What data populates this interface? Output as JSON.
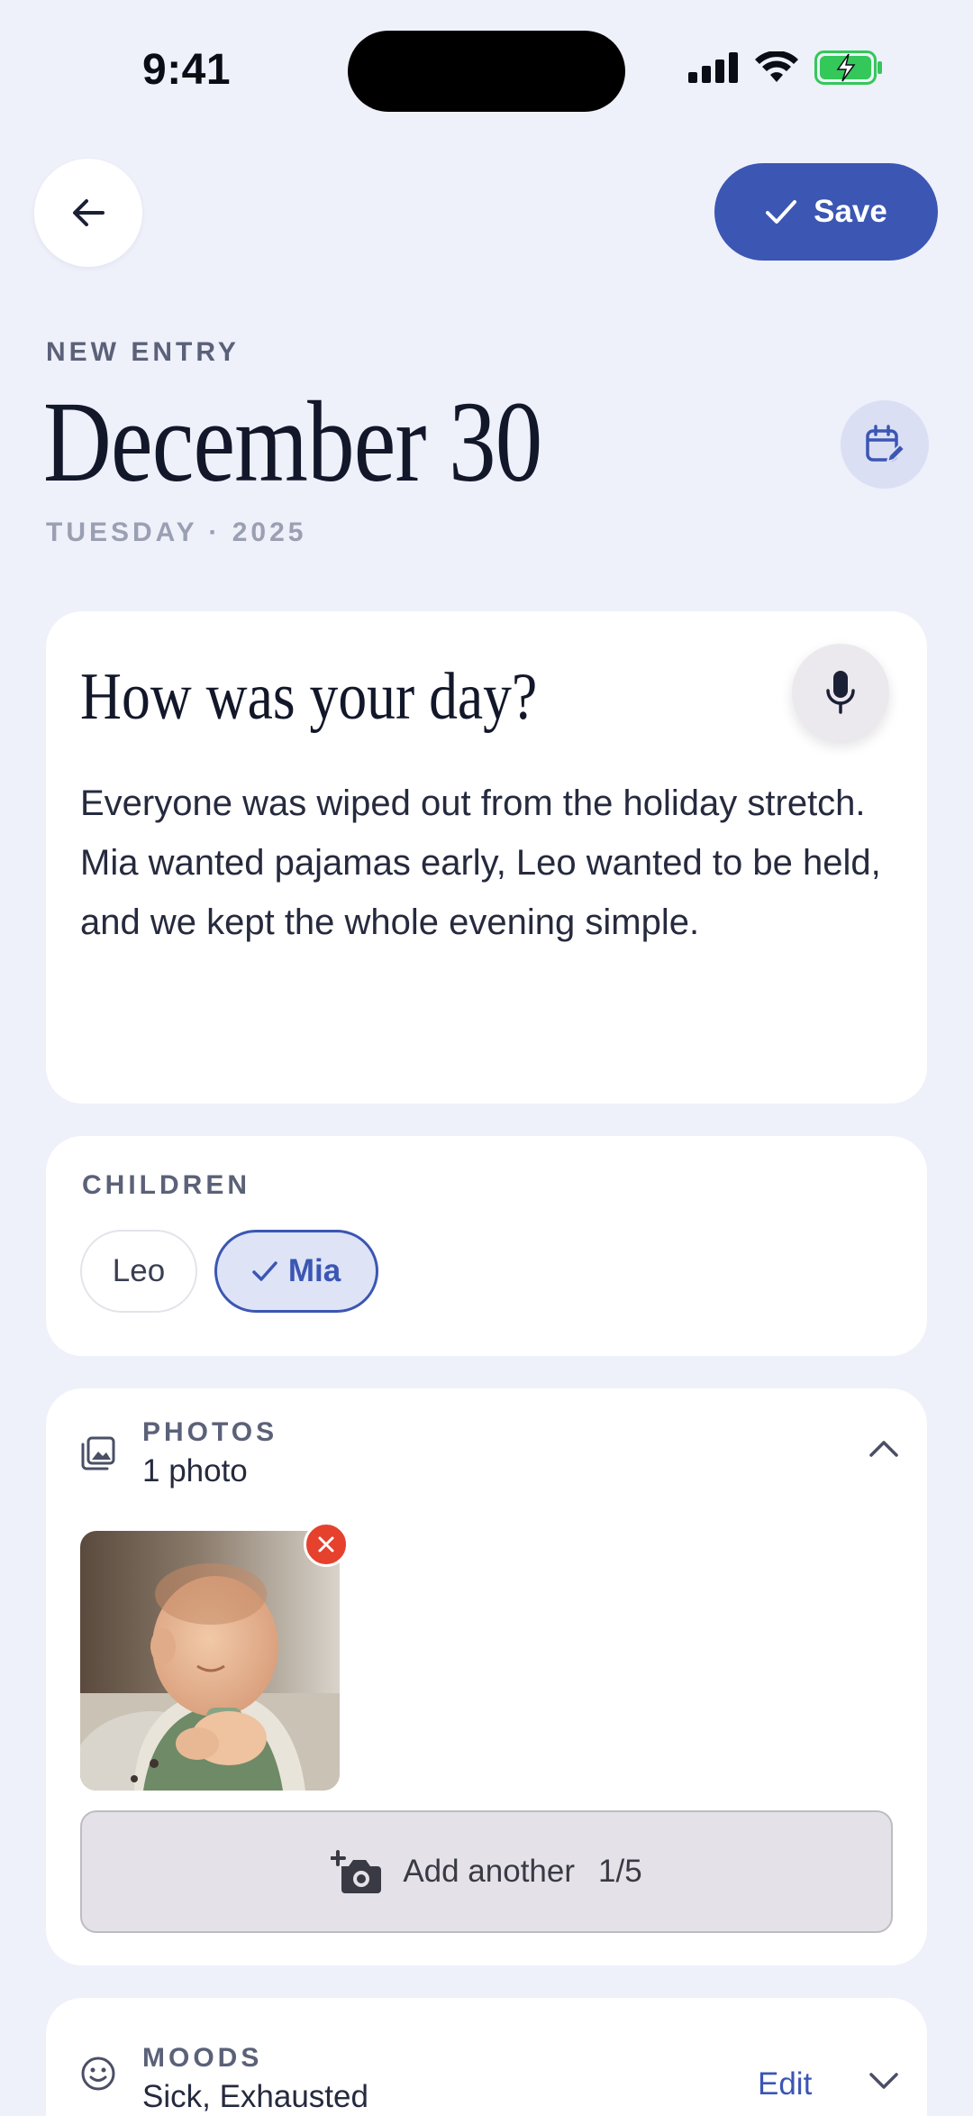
{
  "status_bar": {
    "time": "9:41"
  },
  "header": {
    "save_label": "Save"
  },
  "entry": {
    "eyebrow": "NEW ENTRY",
    "date_title": "December 30",
    "date_sub": "TUESDAY · 2025"
  },
  "journal": {
    "prompt": "How was your day?",
    "text": "Everyone was wiped out from the holiday stretch. Mia wanted pajamas early, Leo wanted to be held, and we kept the whole evening simple."
  },
  "children": {
    "label": "CHILDREN",
    "chips": [
      {
        "name": "Leo",
        "selected": false
      },
      {
        "name": "Mia",
        "selected": true
      }
    ]
  },
  "photos": {
    "label": "PHOTOS",
    "count_text": "1 photo",
    "add_label": "Add another",
    "add_count": "1/5"
  },
  "moods": {
    "label": "MOODS",
    "values": "Sick, Exhausted",
    "edit_label": "Edit"
  },
  "colors": {
    "accent": "#3b56b3",
    "background": "#eef0fa",
    "danger": "#e5412d",
    "battery": "#34c759"
  }
}
